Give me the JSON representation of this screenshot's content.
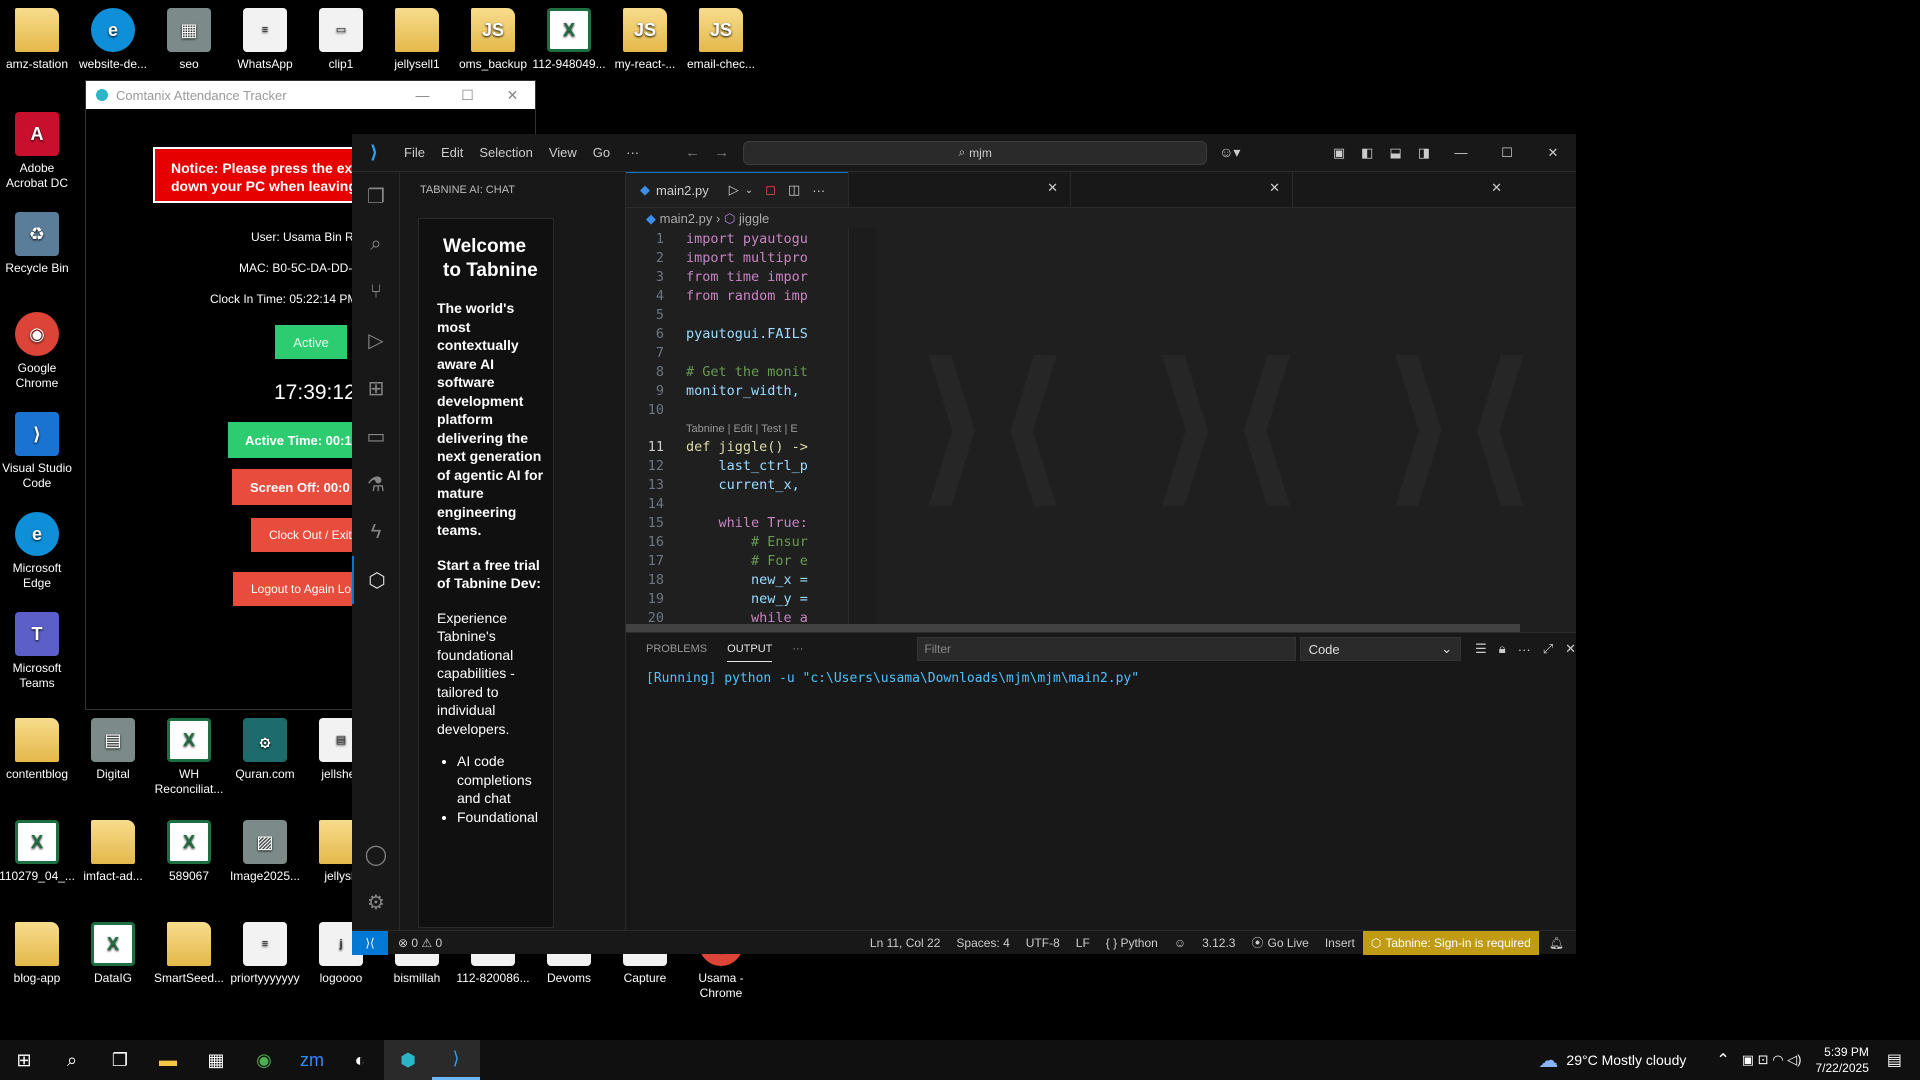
{
  "desktop_icons": [
    {
      "label": "amz-station",
      "type": "folder",
      "glyph": ""
    },
    {
      "label": "website-de...",
      "type": "edge",
      "glyph": "e"
    },
    {
      "label": "seo",
      "type": "img",
      "glyph": "▦"
    },
    {
      "label": "WhatsApp",
      "type": "doc",
      "glyph": "≡"
    },
    {
      "label": "clip1",
      "type": "doc",
      "glyph": "▭"
    },
    {
      "label": "jellysell1",
      "type": "folder",
      "glyph": ""
    },
    {
      "label": "oms_backup",
      "type": "folder",
      "glyph": "JS"
    },
    {
      "label": "112-948049...",
      "type": "excel",
      "glyph": "X"
    },
    {
      "label": "my-react-...",
      "type": "folder",
      "glyph": "JS"
    },
    {
      "label": "email-chec...",
      "type": "folder",
      "glyph": "JS"
    },
    {
      "label": "Adobe Acrobat DC",
      "type": "acrobat",
      "glyph": "A"
    },
    {
      "label": "Recycle Bin",
      "type": "bin",
      "glyph": "♻"
    },
    {
      "label": "Google Chrome",
      "type": "chrome",
      "glyph": "◉"
    },
    {
      "label": "Visual Studio Code",
      "type": "vscode",
      "glyph": "⟩"
    },
    {
      "label": "Microsoft Edge",
      "type": "edge",
      "glyph": "e"
    },
    {
      "label": "Microsoft Teams",
      "type": "teams",
      "glyph": "T"
    },
    {
      "label": "contentblog",
      "type": "folder",
      "glyph": ""
    },
    {
      "label": "Digital",
      "type": "img",
      "glyph": "▤"
    },
    {
      "label": "WH Reconciliat...",
      "type": "excel",
      "glyph": "X"
    },
    {
      "label": "Quran.com",
      "type": "quran",
      "glyph": "۞"
    },
    {
      "label": "jellshell",
      "type": "doc",
      "glyph": "▤"
    },
    {
      "label": "110279_04_...",
      "type": "excel",
      "glyph": "X"
    },
    {
      "label": "imfact-ad...",
      "type": "folder",
      "glyph": ""
    },
    {
      "label": "589067",
      "type": "excel",
      "glyph": "X"
    },
    {
      "label": "Image2025...",
      "type": "img",
      "glyph": "▨"
    },
    {
      "label": "jellysh",
      "type": "folder",
      "glyph": ""
    },
    {
      "label": "blog-app",
      "type": "folder",
      "glyph": ""
    },
    {
      "label": "DataIG",
      "type": "excel",
      "glyph": "X"
    },
    {
      "label": "SmartSeed...",
      "type": "folder",
      "glyph": ""
    },
    {
      "label": "priortyyyyyyy",
      "type": "doc",
      "glyph": "≡"
    },
    {
      "label": "logoooo",
      "type": "doc",
      "glyph": "j"
    },
    {
      "label": "bismillah",
      "type": "doc",
      "glyph": ""
    },
    {
      "label": "112-820086...",
      "type": "doc",
      "glyph": ""
    },
    {
      "label": "Devoms",
      "type": "doc",
      "glyph": ""
    },
    {
      "label": "Capture",
      "type": "doc",
      "glyph": ""
    },
    {
      "label": "Usama - Chrome",
      "type": "chrome",
      "glyph": "◉"
    }
  ],
  "attendance": {
    "title": "Comtanix Attendance Tracker",
    "notice": "Notice: Please press the exit button or shut down your PC when leaving",
    "user": "User: Usama Bin Ra",
    "mac": "MAC: B0-5C-DA-DD-",
    "clock_in": "Clock In Time: 05:22:14 PM",
    "status_btn": "Active",
    "clock": "17:39:12",
    "active_time": "Active Time: 00:1",
    "screen_off": "Screen Off: 00:0",
    "clock_out": "Clock Out / Exit",
    "logout": "Logout to Again Lo",
    "minimize": "—",
    "maximize": "☐",
    "close": "✕"
  },
  "vscode": {
    "menu": [
      "File",
      "Edit",
      "Selection",
      "View",
      "Go",
      "···"
    ],
    "search": "mjm",
    "sidebar_title": "TABNINE AI: CHAT",
    "tabnine": {
      "welcome": "Welcome to Tabnine",
      "para1": "The world's most contextually aware AI software development platform delivering the next generation of agentic AI for mature engineering teams.",
      "para2": "Start a free trial of Tabnine Dev:",
      "para3": "Experience Tabnine's foundational capabilities - tailored to individual developers.",
      "bullets": [
        "AI code completions and chat",
        "Foundational"
      ]
    },
    "tab": "main2.py",
    "breadcrumb_file": "main2.py",
    "breadcrumb_symbol": "jiggle",
    "codelens": "Tabnine | Edit | Test | E",
    "code": [
      {
        "n": "1",
        "t": "import pyautogu",
        "c": "kw"
      },
      {
        "n": "2",
        "t": "import multipro",
        "c": "kw"
      },
      {
        "n": "3",
        "t": "from time impor",
        "c": "kw"
      },
      {
        "n": "4",
        "t": "from random imp",
        "c": "kw"
      },
      {
        "n": "5",
        "t": "",
        "c": ""
      },
      {
        "n": "6",
        "t": "pyautogui.FAILS",
        "c": "vr"
      },
      {
        "n": "7",
        "t": "",
        "c": ""
      },
      {
        "n": "8",
        "t": "# Get the monit",
        "c": "cm"
      },
      {
        "n": "9",
        "t": "monitor_width, ",
        "c": "vr"
      },
      {
        "n": "10",
        "t": "",
        "c": ""
      },
      {
        "n": "11",
        "t": "def jiggle() ->",
        "c": "fn"
      },
      {
        "n": "12",
        "t": "    last_ctrl_p",
        "c": "vr"
      },
      {
        "n": "13",
        "t": "    current_x, ",
        "c": "vr"
      },
      {
        "n": "14",
        "t": "",
        "c": ""
      },
      {
        "n": "15",
        "t": "    while True:",
        "c": "kw"
      },
      {
        "n": "16",
        "t": "        # Ensur",
        "c": "cm"
      },
      {
        "n": "17",
        "t": "        # For e",
        "c": "cm"
      },
      {
        "n": "18",
        "t": "        new_x =",
        "c": "vr"
      },
      {
        "n": "19",
        "t": "        new_y =",
        "c": "vr"
      },
      {
        "n": "20",
        "t": "        while a",
        "c": "kw"
      }
    ],
    "panel_tabs": [
      "PROBLEMS",
      "OUTPUT",
      "···"
    ],
    "filter_placeholder": "Filter",
    "output_select": "Code",
    "output_line": "[Running] python -u \"c:\\Users\\usama\\Downloads\\mjm\\mjm\\main2.py\"",
    "status": {
      "errors": "⊗ 0  ⚠ 0",
      "position": "Ln 11, Col 22",
      "spaces": "Spaces: 4",
      "encoding": "UTF-8",
      "eol": "LF",
      "language": "{ } Python",
      "version": "3.12.3",
      "golive": "Go Live",
      "insert": "Insert",
      "tabnine": "Tabnine: Sign-in is required"
    }
  },
  "taskbar": {
    "weather": "29°C  Mostly cloudy",
    "time": "5:39 PM",
    "date": "7/22/2025"
  },
  "colors": {
    "notice_red": "#e60000",
    "green": "#2ecc71",
    "red": "#e74c3c",
    "vscode_blue": "#0078d4",
    "tabnine_yellow": "#c09b14"
  }
}
